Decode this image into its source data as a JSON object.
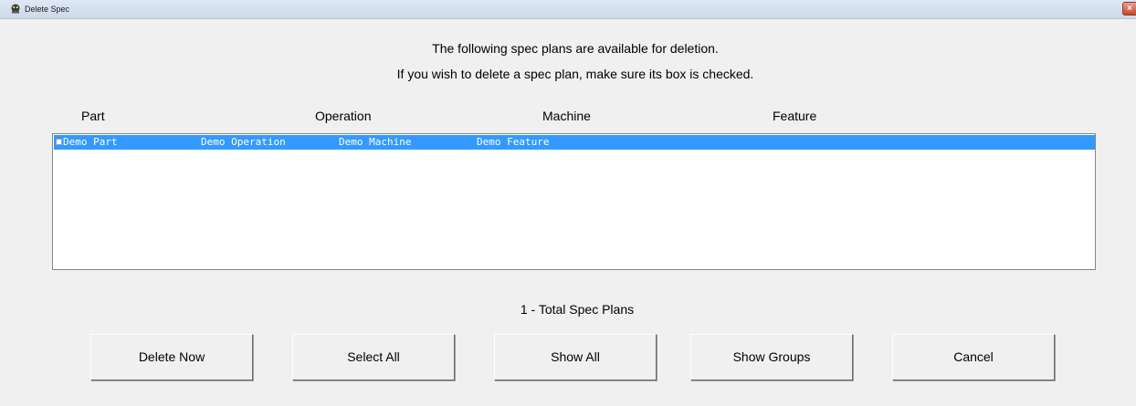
{
  "window": {
    "title": "Delete Spec",
    "close_glyph": "×",
    "icon": "app-icon"
  },
  "instructions": {
    "line1": "The following spec plans are available for deletion.",
    "line2": "If you wish to delete a spec plan, make sure its box is checked."
  },
  "columns": {
    "part": "Part",
    "operation": "Operation",
    "machine": "Machine",
    "feature": "Feature"
  },
  "rows": [
    {
      "checked": false,
      "selected": true,
      "part": "Demo Part",
      "operation": "Demo Operation",
      "machine": "Demo Machine",
      "feature": "Demo Feature"
    }
  ],
  "total_text": "1 - Total Spec Plans",
  "buttons": {
    "delete_now": "Delete Now",
    "select_all": "Select All",
    "show_all": "Show All",
    "show_groups": "Show Groups",
    "cancel": "Cancel"
  },
  "colors": {
    "selection": "#3399ff",
    "dialog_bg": "#f0f0f0",
    "close_button": "#c7452c"
  }
}
